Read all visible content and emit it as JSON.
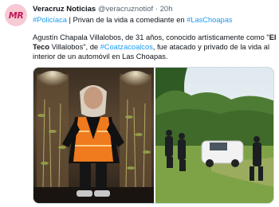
{
  "author": {
    "avatar_text": "MR",
    "name": "Veracruz Noticias",
    "handle": "@veracruznotiof",
    "separator": "·",
    "time": "20h"
  },
  "tweet": {
    "tag1": "#Policíaca",
    "title_text": " | Privan de la vida a comediante en ",
    "tag2": "#LasChoapas",
    "body_part1": "Agustín Chapala Villalobos, de 31 años, conocido artísticamente como \"",
    "body_bold": "El Teco",
    "body_part2": " Villalobos\", de ",
    "tag3": "#Coatzacoalcos",
    "body_part3": ", fue atacado y privado de la vida al interior de un automóvil en Las Choapas."
  },
  "colors": {
    "link": "#1d9bf0",
    "vest": "#f07a1e",
    "car": "#f2f2f2"
  }
}
